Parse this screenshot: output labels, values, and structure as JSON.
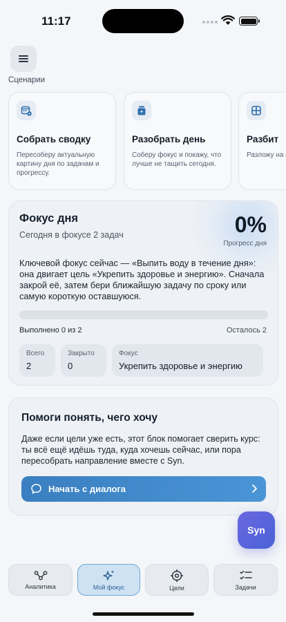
{
  "status_bar": {
    "time": "11:17"
  },
  "header": {
    "section_label": "Сценарии"
  },
  "scenarios": [
    {
      "title": "Собрать сводку",
      "description": "Пересоберу актуальную картину дня по задачам и прогрессу.",
      "icon": "calendar-spark-icon"
    },
    {
      "title": "Разобрать день",
      "description": "Соберу фокус и покажу, что лучше не тащить сегодня.",
      "icon": "stack-plus-icon"
    },
    {
      "title": "Разбит",
      "description": "Разложу на понят",
      "icon": "grid-icon"
    }
  ],
  "focus": {
    "title": "Фокус дня",
    "subtitle": "Сегодня в фокусе 2 задач",
    "percent": "0%",
    "percent_label": "Прогресс дня",
    "progress": 0,
    "text": "Ключевой фокус сейчас — «Выпить воду в течение дня»: она двигает цель «Укрепить здоровье и энергию». Сначала закрой её, затем бери ближайшую задачу по сроку или самую короткую оставшуюся.",
    "done": "Выполнено 0 из 2",
    "left": "Осталось 2",
    "stats": [
      {
        "label": "Всего",
        "value": "2"
      },
      {
        "label": "Закрыто",
        "value": "0"
      },
      {
        "label": "Фокус",
        "value": "Укрепить здоровье и энергию"
      }
    ]
  },
  "help": {
    "title": "Помоги понять, чего хочу",
    "text": "Даже если цели уже есть, этот блок помогает сверить курс: ты всё ещё идёшь туда, куда хочешь сейчас, или пора пересобрать направление вместе с Syn.",
    "button_label": "Начать с диалога"
  },
  "fab": {
    "label": "Syn"
  },
  "tabs": [
    {
      "label": "Аналитика",
      "icon": "analytics-nodes-icon"
    },
    {
      "label": "Мой фокус",
      "icon": "sparkle-icon",
      "active": true
    },
    {
      "label": "Цели",
      "icon": "crosshair-icon"
    },
    {
      "label": "Задачи",
      "icon": "checklist-icon"
    }
  ],
  "colors": {
    "accent": "#3b82c4",
    "fab": "#5a63dc",
    "active_tab": "#cfe2f3"
  }
}
